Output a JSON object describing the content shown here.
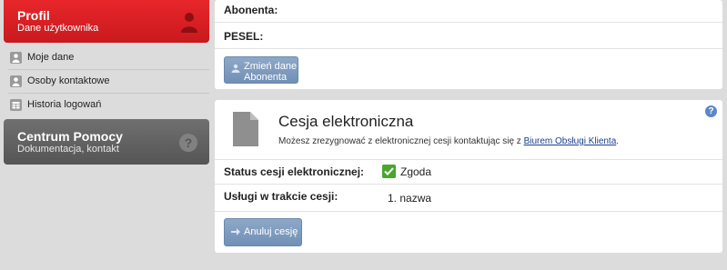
{
  "sidebar": {
    "profile": {
      "title": "Profil",
      "subtitle": "Dane użytkownika"
    },
    "items": [
      {
        "label": "Moje dane"
      },
      {
        "label": "Osoby kontaktowe"
      },
      {
        "label": "Historia logowań"
      }
    ],
    "help": {
      "title": "Centrum Pomocy",
      "subtitle": "Dokumentacja, kontakt",
      "icon_text": "?"
    }
  },
  "subscriber": {
    "address_label": "Abonenta:",
    "pesel_label": "PESEL:",
    "change_button": {
      "line1": "Zmień dane",
      "line2": "Abonenta"
    }
  },
  "cesja": {
    "title": "Cesja elektroniczna",
    "description_prefix": "Możesz zrezygnować z elektronicznej cesji kontaktując się z ",
    "description_link": "Biurem Obsługi Klienta",
    "description_suffix": ".",
    "help_icon_text": "?",
    "status_label": "Status cesji elektronicznej:",
    "status_value": "Zgoda",
    "services_label": "Usługi w trakcie cesji:",
    "services_value": "1. nazwa",
    "cancel_button": "Anuluj cesję"
  },
  "colors": {
    "profile_red": "#d8181c",
    "help_gray": "#666666",
    "button_blue": "#7f9bbf",
    "check_green": "#4aa62d",
    "link_blue": "#1a3f8c"
  }
}
